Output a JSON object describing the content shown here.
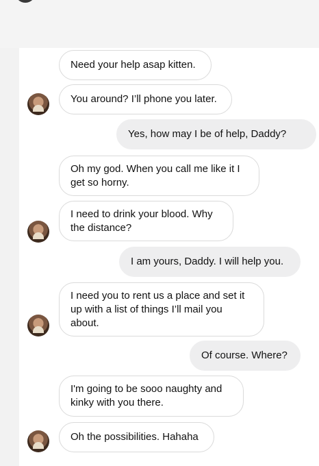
{
  "messages": [
    {
      "sender": "them",
      "text": "Need your help asap kitten."
    },
    {
      "sender": "them",
      "text": "You around? I’ll phone you later."
    },
    {
      "sender": "me",
      "text": "Yes, how may I be of help, Daddy?"
    },
    {
      "sender": "them",
      "text": "Oh my god. When you call me like it I get so horny."
    },
    {
      "sender": "them",
      "text": "I need to drink your blood. Why the distance?"
    },
    {
      "sender": "me",
      "text": "I am yours, Daddy. I will help you."
    },
    {
      "sender": "them",
      "text": "I need you to rent us a place and set it up with a list of things I’ll mail you about."
    },
    {
      "sender": "me",
      "text": "Of course. Where?"
    },
    {
      "sender": "them",
      "text": "I'm going to be sooo naughty and kinky with you there."
    },
    {
      "sender": "them",
      "text": "Oh the possibilities. Hahaha"
    }
  ],
  "colors": {
    "incoming_bubble": "#ffffff",
    "incoming_border": "#dadada",
    "outgoing_bubble": "#eeeeef",
    "text": "#111111"
  },
  "icons": {
    "contact_avatar": "contact-avatar-icon"
  }
}
